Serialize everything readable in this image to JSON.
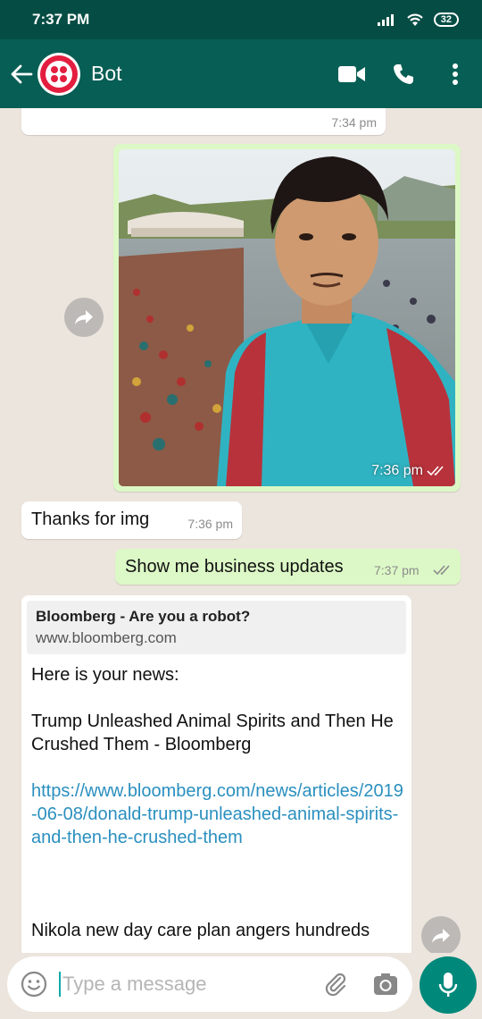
{
  "status_bar": {
    "time": "7:37 PM",
    "battery": "32"
  },
  "header": {
    "name": "Bot"
  },
  "messages": [
    {
      "type": "text",
      "direction": "in",
      "time": "7:34 pm"
    },
    {
      "type": "image",
      "direction": "out",
      "time": "7:36 pm",
      "status": "read"
    },
    {
      "type": "text",
      "direction": "in",
      "text": "Thanks for img",
      "time": "7:36 pm"
    },
    {
      "type": "text",
      "direction": "out",
      "text": "Show me business updates",
      "time": "7:37 pm",
      "status": "read"
    },
    {
      "type": "link",
      "direction": "in",
      "preview_title": "Bloomberg - Are you a robot?",
      "preview_domain": "www.bloomberg.com",
      "intro": "Here is your news:",
      "headline": "Trump Unleashed Animal Spirits and Then He Crushed Them - Bloomberg",
      "url": "https://www.bloomberg.com/news/articles/2019-06-08/donald-trump-unleashed-animal-spirits-and-then-he-crushed-them",
      "next_line_partial": "Nikola new day care plan angers hundreds"
    }
  ],
  "input": {
    "placeholder": "Type a message"
  },
  "colors": {
    "header": "#075e54",
    "status_bar": "#054d44",
    "outgoing": "#dcf8c6",
    "accent": "#00897b",
    "link": "#2a8fbf"
  }
}
